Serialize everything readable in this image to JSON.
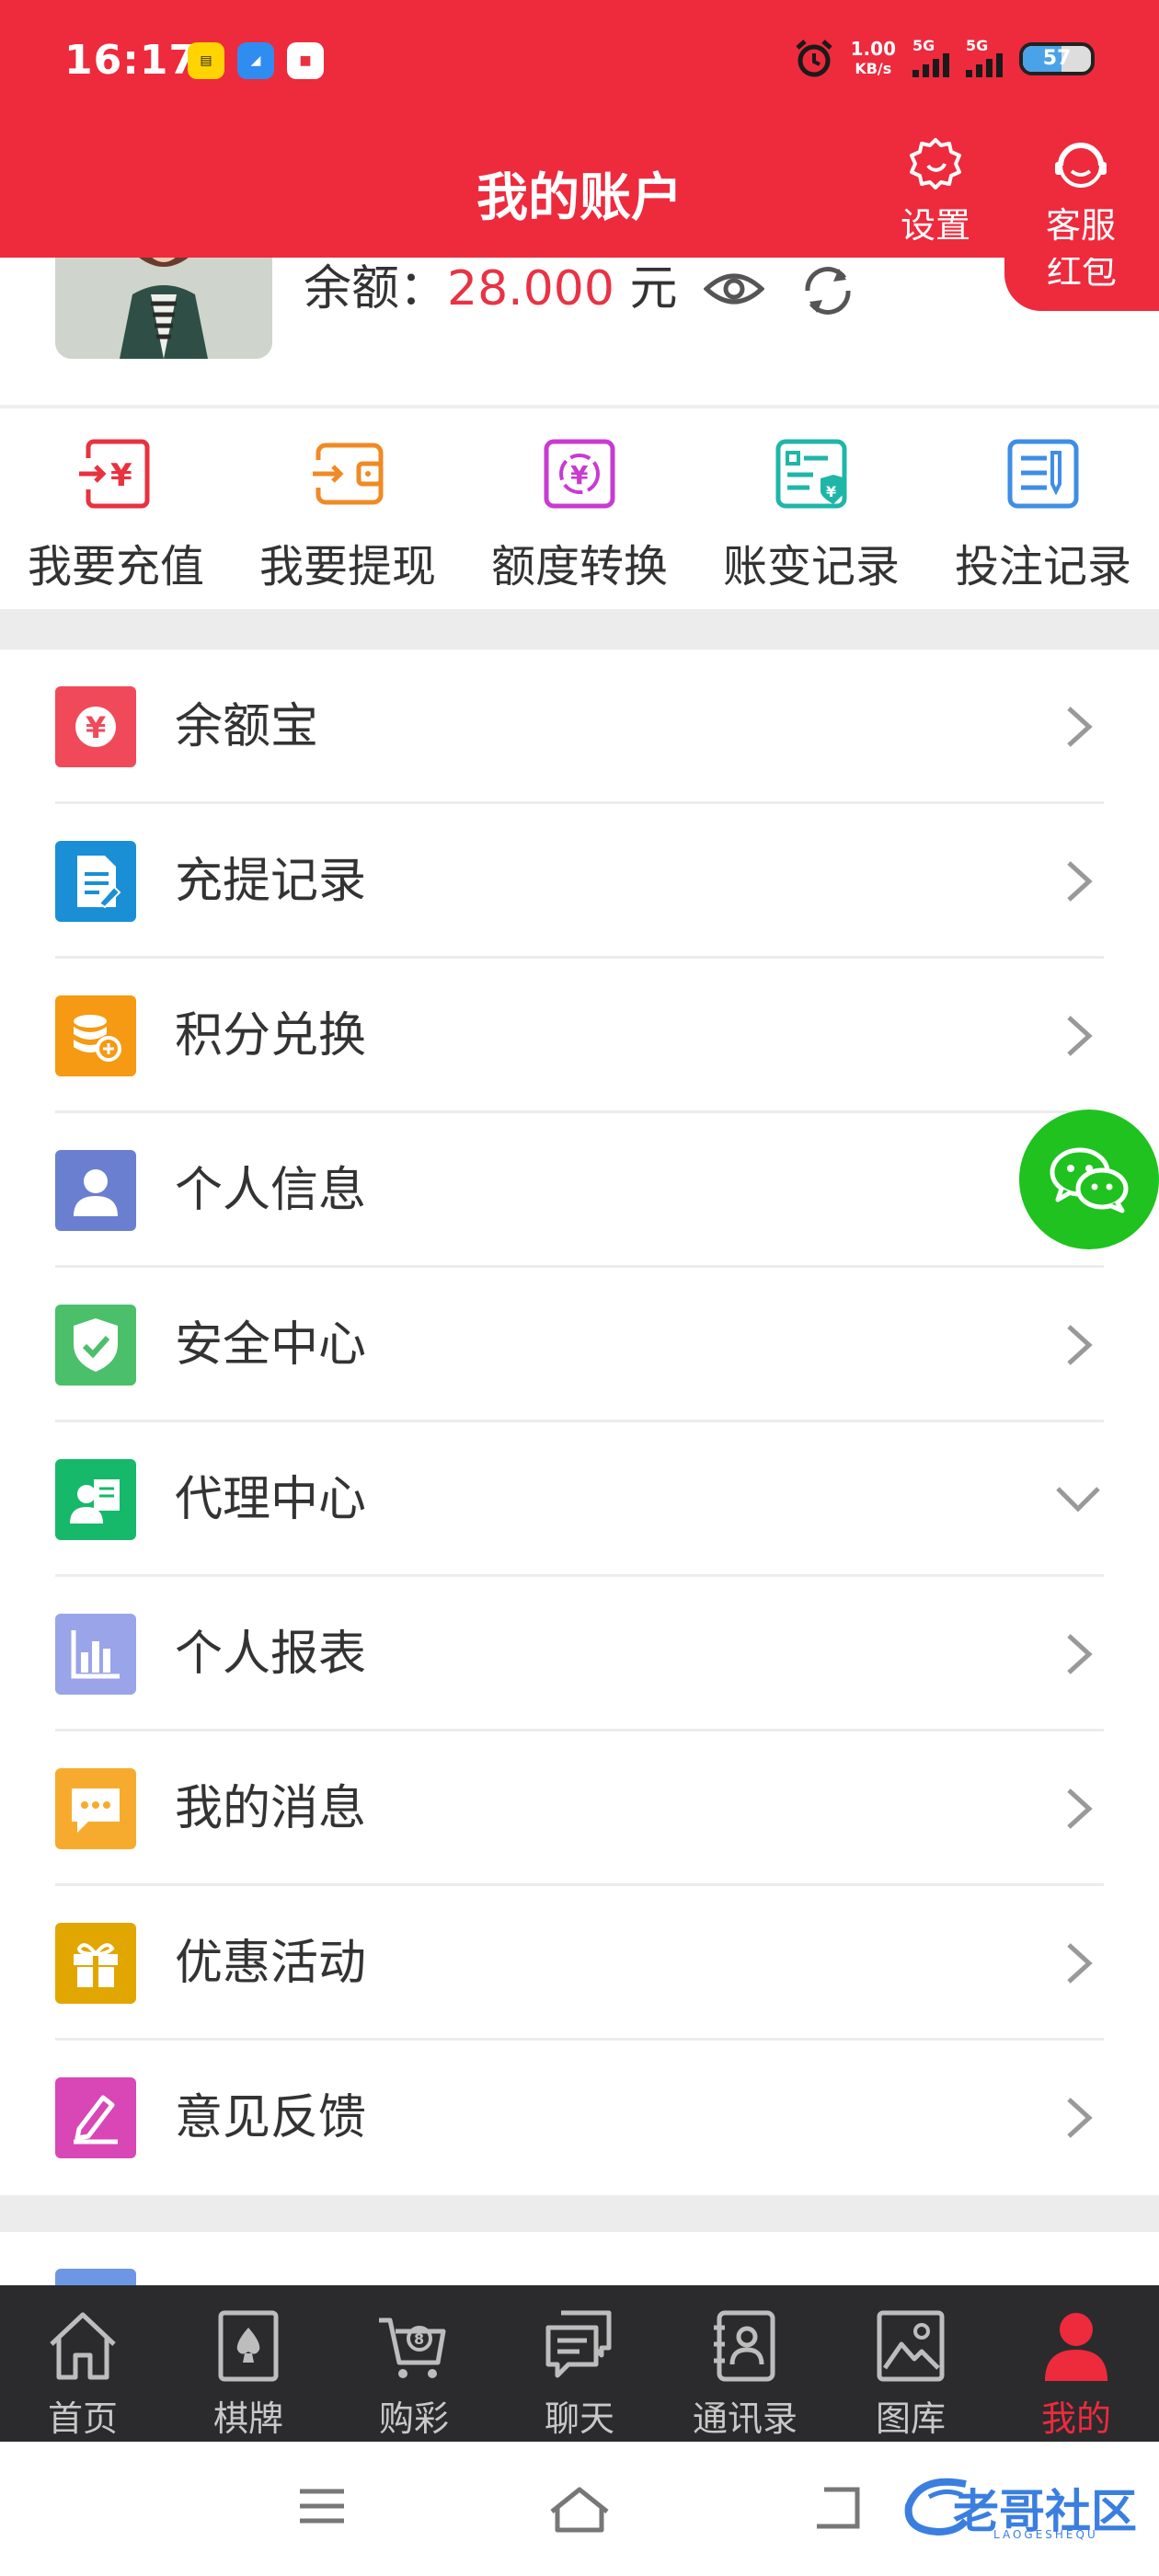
{
  "status_bar": {
    "time": "16:17",
    "net_speed_value": "1.00",
    "net_speed_unit": "KB/s",
    "signal1_label": "5G",
    "signal2_label": "5G",
    "battery": "57"
  },
  "header": {
    "title": "我的账户",
    "settings_label": "设置",
    "service_label": "客服"
  },
  "balance": {
    "label": "余额：",
    "amount": "28.000",
    "unit": "元",
    "hongbao_label": "红包"
  },
  "quick_actions": [
    {
      "label": "我要充值",
      "icon": "recharge-icon",
      "color": "#e8323f"
    },
    {
      "label": "我要提现",
      "icon": "withdraw-icon",
      "color": "#f08a24"
    },
    {
      "label": "额度转换",
      "icon": "transfer-icon",
      "color": "#c93ad2"
    },
    {
      "label": "账变记录",
      "icon": "account-change-icon",
      "color": "#1fb6a8"
    },
    {
      "label": "投注记录",
      "icon": "bet-record-icon",
      "color": "#3f8ee6"
    }
  ],
  "menu": [
    {
      "label": "余额宝",
      "icon": "yuebao-icon",
      "color": "#f04a5a",
      "arrow": "right"
    },
    {
      "label": "充提记录",
      "icon": "record-icon",
      "color": "#1a8fd6",
      "arrow": "right"
    },
    {
      "label": "积分兑换",
      "icon": "points-icon",
      "color": "#f59a12",
      "arrow": "right"
    },
    {
      "label": "个人信息",
      "icon": "user-icon",
      "color": "#6a7fd0",
      "arrow": "right"
    },
    {
      "label": "安全中心",
      "icon": "shield-icon",
      "color": "#4cbf6a",
      "arrow": "right"
    },
    {
      "label": "代理中心",
      "icon": "agent-icon",
      "color": "#16b86a",
      "arrow": "down"
    },
    {
      "label": "个人报表",
      "icon": "report-icon",
      "color": "#9aa4e8",
      "arrow": "right"
    },
    {
      "label": "我的消息",
      "icon": "message-icon",
      "color": "#f7ab2e",
      "arrow": "right"
    },
    {
      "label": "优惠活动",
      "icon": "gift-icon",
      "color": "#e2a600",
      "arrow": "right"
    },
    {
      "label": "意见反馈",
      "icon": "feedback-icon",
      "color": "#d946b5",
      "arrow": "right"
    }
  ],
  "tabs": [
    {
      "label": "首页",
      "icon": "home-icon"
    },
    {
      "label": "棋牌",
      "icon": "cards-icon"
    },
    {
      "label": "购彩",
      "icon": "cart-icon"
    },
    {
      "label": "聊天",
      "icon": "chat-icon"
    },
    {
      "label": "通讯录",
      "icon": "contacts-icon"
    },
    {
      "label": "图库",
      "icon": "gallery-icon"
    },
    {
      "label": "我的",
      "icon": "profile-icon",
      "active": true
    }
  ],
  "watermark": {
    "text": "老哥社区",
    "sub": "LAOGESHEQU"
  },
  "colors": {
    "primary": "#ee2a3d",
    "tabbar": "#2b2b2d",
    "wechat": "#1fc21f"
  }
}
